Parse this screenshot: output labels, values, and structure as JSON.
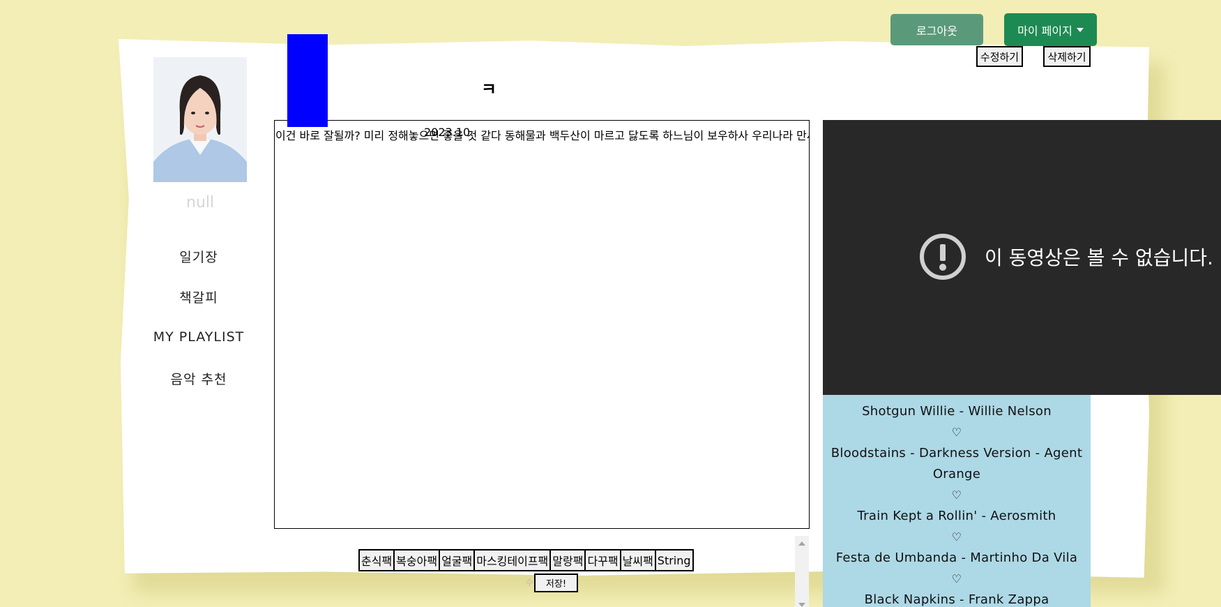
{
  "header": {
    "logout_label": "로그아웃",
    "mypage_label": "마이 페이지"
  },
  "diary_actions": {
    "edit_label": "수정하기",
    "delete_label": "삭제하기"
  },
  "profile": {
    "nickname": "null"
  },
  "sidebar": {
    "items": [
      {
        "label": "일기장"
      },
      {
        "label": "책갈피"
      },
      {
        "label": "MY PLAYLIST"
      },
      {
        "label": "음악 추천"
      }
    ]
  },
  "diary": {
    "title": "ㅋ",
    "date": "2023.10.",
    "content": "이건 바로 잘될까? 미리 정해놓으면 좋을 것 같다 동해물과 백두산이 마르고 닳도록 하느님이 보우하사 우리나라 만세"
  },
  "video": {
    "message": "이 동영상은 볼 수 없습니다."
  },
  "playlist": {
    "heart": "♡",
    "songs": [
      "Shotgun Willie - Willie Nelson",
      "Bloodstains - Darkness Version - Agent Orange",
      "Train Kept a Rollin' - Aerosmith",
      "Festa de Umbanda - Martinho Da Vila",
      "Black Napkins - Frank Zappa"
    ]
  },
  "stickers": [
    "춘식팩",
    "복숭아팩",
    "얼굴팩",
    "마스킹테이프팩",
    "말랑팩",
    "다꾸팩",
    "날씨팩",
    "String"
  ],
  "save_label": "저장!",
  "save_ghost": "수",
  "colors": {
    "background": "#f3eeb6",
    "logout_button": "#5a9a7a",
    "mypage_button": "#1e8a53",
    "playlist_bg": "#add8e6",
    "video_bg": "#282828",
    "blue_box": "#0000ff"
  }
}
